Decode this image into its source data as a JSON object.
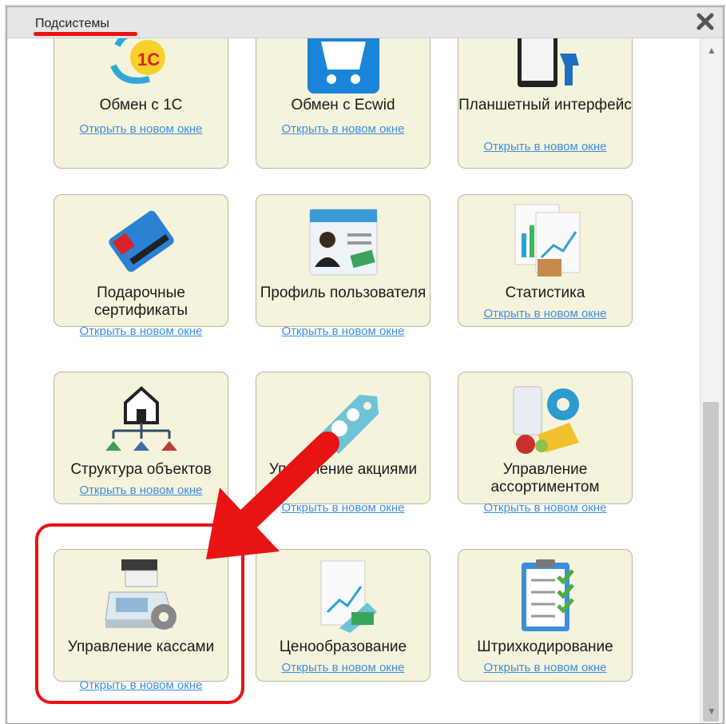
{
  "window": {
    "title": "Подсистемы"
  },
  "tiles": [
    {
      "name": "Обмен с 1С",
      "link": "Открыть в новом окне",
      "icon": "exchange-1c-icon"
    },
    {
      "name": "Обмен с Ecwid",
      "link": "Открыть в новом окне",
      "icon": "ecwid-cart-icon"
    },
    {
      "name": "Планшетный интерфейс",
      "link": "Открыть в новом окне",
      "icon": "tablet-scanner-icon"
    },
    {
      "name": "Подарочные сертификаты",
      "link": "Открыть в новом окне",
      "icon": "gift-card-icon"
    },
    {
      "name": "Профиль пользователя",
      "link": "Открыть в новом окне",
      "icon": "user-profile-icon"
    },
    {
      "name": "Статистика",
      "link": "Открыть в новом окне",
      "icon": "statistics-icon"
    },
    {
      "name": "Структура объектов",
      "link": "Открыть в новом окне",
      "icon": "object-structure-icon"
    },
    {
      "name": "Управление акциями",
      "link": "Открыть в новом окне",
      "icon": "promo-tag-icon"
    },
    {
      "name": "Управление ассортиментом",
      "link": "Открыть в новом окне",
      "icon": "assortment-icon"
    },
    {
      "name": "Управление кассами",
      "link": "Открыть в новом окне",
      "icon": "cash-register-icon"
    },
    {
      "name": "Ценообразование",
      "link": "Открыть в новом окне",
      "icon": "pricing-icon"
    },
    {
      "name": "Штрихкодирование",
      "link": "Открыть в новом окне",
      "icon": "barcode-checklist-icon"
    }
  ],
  "colors": {
    "accent": "#e81313",
    "tile_bg": "#f6f3dc",
    "link": "#3a8fe0"
  }
}
